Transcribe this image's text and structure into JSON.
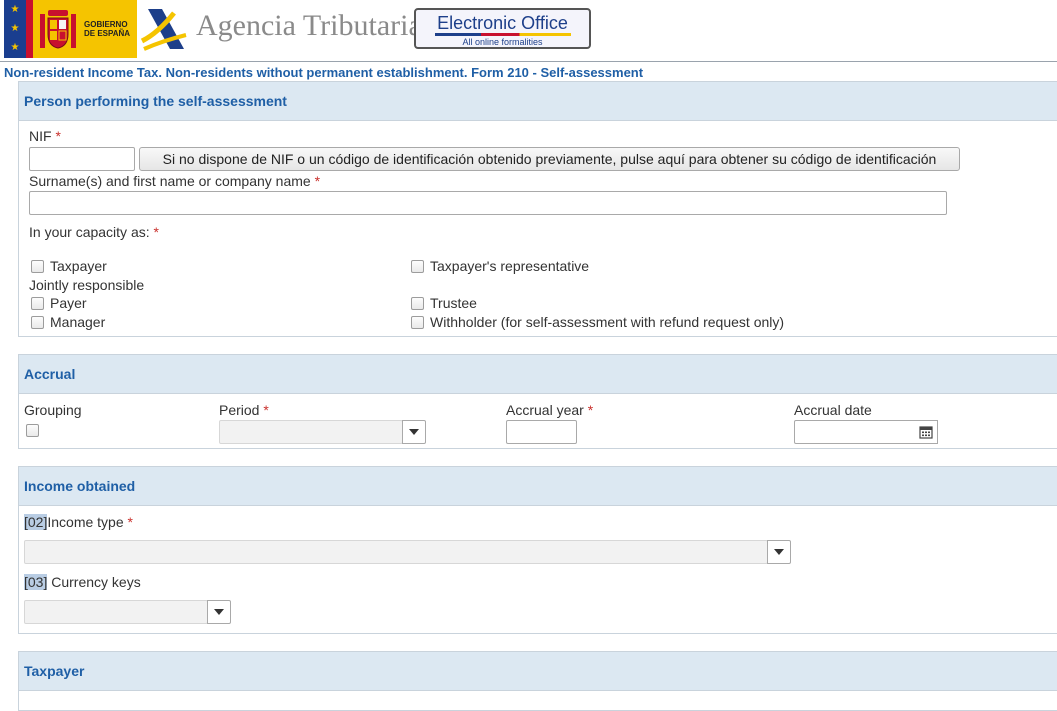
{
  "header": {
    "gov_text_line1": "GOBIERNO",
    "gov_text_line2": "DE ESPAÑA",
    "agency_name": "Agencia Tributaria",
    "eoffice_title": "Electronic Office",
    "eoffice_subtitle": "All online formalities"
  },
  "page_title": "Non-resident Income Tax. Non-residents without permanent establishment. Form 210 - Self-assessment",
  "person_section": {
    "title": "Person performing the self-assessment",
    "nif_label": "NIF",
    "nif_value": "",
    "nif_button": "Si no dispone de NIF o un código de identificación obtenido previamente, pulse aquí para obtener su código de identificación",
    "name_label": "Surname(s) and first name or company name",
    "name_value": "",
    "capacity_label": "In your capacity as:",
    "taxpayer": "Taxpayer",
    "representative": "Taxpayer's representative",
    "jointly_responsible": "Jointly responsible",
    "payer": "Payer",
    "trustee": "Trustee",
    "manager": "Manager",
    "withholder": "Withholder (for self-assessment with refund request only)"
  },
  "accrual_section": {
    "title": "Accrual",
    "grouping_label": "Grouping",
    "period_label": "Period",
    "period_value": "",
    "year_label": "Accrual year",
    "year_value": "",
    "date_label": "Accrual date",
    "date_value": ""
  },
  "income_section": {
    "title": "Income obtained",
    "income_type_code": "[02]",
    "income_type_label": "Income type",
    "currency_code": "[03]",
    "currency_label": " Currency keys"
  },
  "taxpayer_section": {
    "title": "Taxpayer"
  },
  "required_marker": "*",
  "colors": {
    "accent": "#1f5fa6",
    "panel_header_bg": "#dce8f2",
    "required": "#c9302c"
  },
  "icons": {
    "calendar": "calendar-icon",
    "dropdown": "chevron-down-icon"
  }
}
